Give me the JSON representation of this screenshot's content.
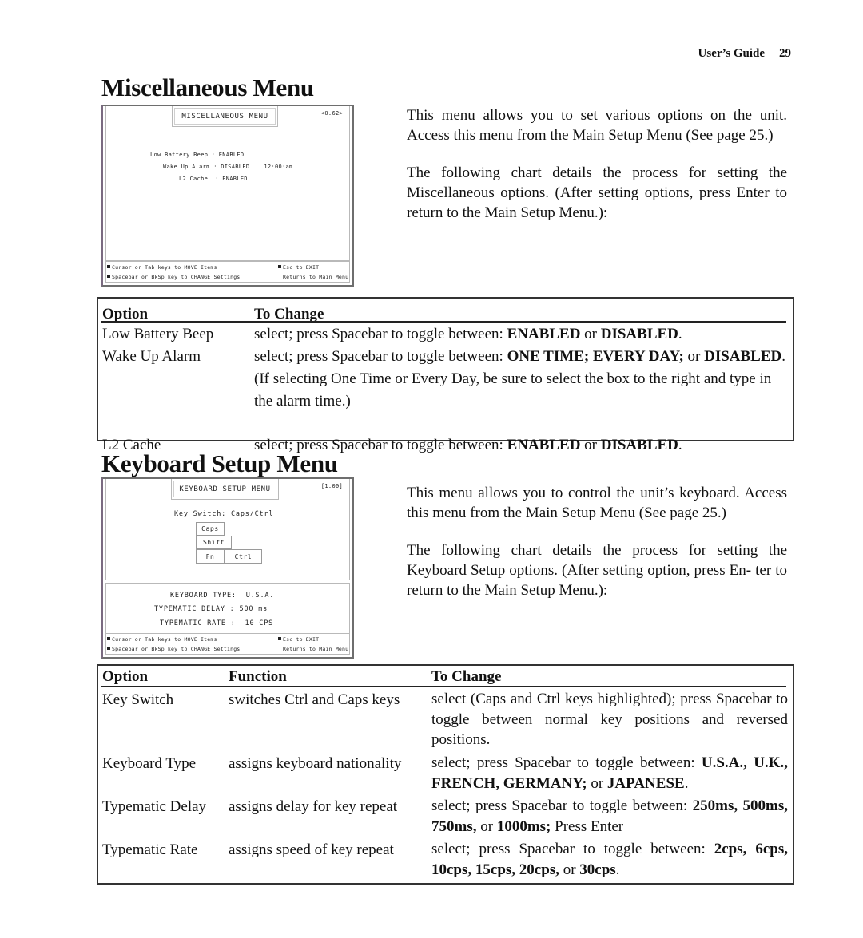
{
  "running_head": {
    "title": "User’s Guide",
    "page": "29"
  },
  "misc": {
    "title": "Miscellaneous Menu",
    "screen": {
      "menu_title": "MISCELLANEOUS MENU",
      "code": "<0.62>",
      "rows": [
        {
          "label": "Low Battery Beep",
          "value": "ENABLED",
          "extra": ""
        },
        {
          "label": "Wake Up Alarm",
          "value": "DISABLED",
          "extra": "12:00:am"
        },
        {
          "label": "L2 Cache",
          "value": "ENABLED",
          "extra": ""
        }
      ],
      "footer": {
        "line1_left": "Cursor or Tab keys to MOVE Items",
        "line1_right": "Esc to EXIT",
        "line2_left": "Spacebar or BkSp key to CHANGE Settings",
        "line2_right": "Returns to Main Menu"
      }
    },
    "desc": [
      "This menu allows you to set various options on the unit. Access this menu from the Main Setup Menu (See page 25.)",
      "The following chart details the process for setting the Miscellaneous options. (After setting options, press Enter to return to the Main Setup Menu.):"
    ],
    "table": {
      "headers": [
        "Option",
        "To Change"
      ],
      "rows": [
        {
          "option": "Low Battery Beep",
          "change": [
            [
              "select; press Spacebar to toggle between: ",
              false
            ],
            [
              "ENABLED",
              true
            ],
            [
              " or ",
              false
            ],
            [
              "DISABLED",
              true
            ],
            [
              ".",
              false
            ]
          ]
        },
        {
          "option": "Wake Up Alarm",
          "change": [
            [
              "select; press Spacebar to toggle between: ",
              false
            ],
            [
              "ONE TIME; EVERY DAY;",
              true
            ],
            [
              " or ",
              false
            ],
            [
              "DISABLED",
              true
            ],
            [
              ". (If selecting One Time or Every Day, be sure to select the box to the right and type in the alarm time.)",
              false
            ]
          ]
        },
        {
          "option": "L2 Cache",
          "change": [
            [
              "select; press Spacebar to toggle between: ",
              false
            ],
            [
              "ENABLED",
              true
            ],
            [
              " or ",
              false
            ],
            [
              "DISABLED",
              true
            ],
            [
              ".",
              false
            ]
          ]
        }
      ]
    }
  },
  "keyboard": {
    "title": "Keyboard Setup Menu",
    "screen": {
      "menu_title": "KEYBOARD SETUP MENU",
      "code": "[1.00]",
      "key_switch_label": "Key Switch: Caps/Ctrl",
      "keys": {
        "caps": "Caps",
        "shift": "Shift",
        "fn": "Fn",
        "ctrl": "Ctrl"
      },
      "keyboard_type_label": "KEYBOARD TYPE:",
      "keyboard_type_value": "U.S.A.",
      "typematic_delay_label": "TYPEMATIC DELAY :",
      "typematic_delay_value": "500 ms",
      "typematic_rate_label": "TYPEMATIC RATE :",
      "typematic_rate_value": "10 CPS",
      "footer": {
        "line1_left": "Cursor or Tab keys to MOVE Items",
        "line1_right": "Esc to EXIT",
        "line2_left": "Spacebar or BkSp key to CHANGE Settings",
        "line2_right": "Returns to Main Menu"
      }
    },
    "desc": [
      "This menu allows you to control the unit’s keyboard. Access this menu from the Main Setup Menu (See page 25.)",
      "The following chart details the process for setting the Keyboard Setup options. (After setting option, press En- ter to return to the Main Setup Menu.):"
    ],
    "table": {
      "headers": [
        "Option",
        "Function",
        "To Change"
      ],
      "rows": [
        {
          "option": "Key Switch",
          "function": "switches Ctrl and Caps keys",
          "change": [
            [
              "select (Caps and Ctrl keys highlighted); press Spacebar to toggle between normal key positions and reversed positions.",
              false
            ]
          ]
        },
        {
          "option": "Keyboard Type",
          "function": "assigns keyboard nationality",
          "change": [
            [
              "select; press Spacebar to toggle between: ",
              false
            ],
            [
              "U.S.A., U.K., FRENCH, GERMANY;",
              true
            ],
            [
              " or ",
              false
            ],
            [
              "JAPANESE",
              true
            ],
            [
              ".",
              false
            ]
          ]
        },
        {
          "option": "Typematic Delay",
          "function": "assigns delay for key repeat",
          "change": [
            [
              "select; press Spacebar to toggle between: ",
              false
            ],
            [
              "250ms, 500ms, 750ms,",
              true
            ],
            [
              " or ",
              false
            ],
            [
              "1000ms;",
              true
            ],
            [
              " Press Enter",
              false
            ]
          ]
        },
        {
          "option": "Typematic Rate",
          "function": "assigns speed of key repeat",
          "change": [
            [
              "select; press Spacebar to toggle between: ",
              false
            ],
            [
              "2cps, 6cps, 10cps, 15cps, 20cps,",
              true
            ],
            [
              " or ",
              false
            ],
            [
              "30cps",
              true
            ],
            [
              ".",
              false
            ]
          ]
        }
      ]
    }
  }
}
